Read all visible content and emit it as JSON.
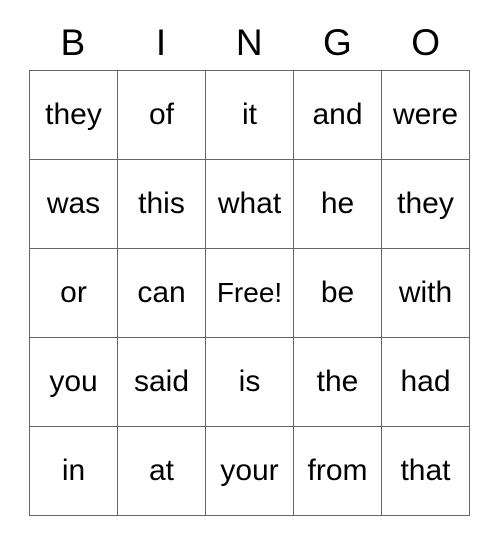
{
  "card": {
    "header": {
      "letters": [
        "B",
        "I",
        "N",
        "G",
        "O"
      ]
    },
    "columns_count": 5,
    "rows_count": 5,
    "free_space_label": "Free!",
    "colors": {
      "text": "#000000",
      "grid_line": "#666666",
      "background": "#ffffff"
    },
    "rows": [
      [
        "they",
        "of",
        "it",
        "and",
        "were"
      ],
      [
        "was",
        "this",
        "what",
        "he",
        "they"
      ],
      [
        "or",
        "can",
        "Free!",
        "be",
        "with"
      ],
      [
        "you",
        "said",
        "is",
        "the",
        "had"
      ],
      [
        "in",
        "at",
        "your",
        "from",
        "that"
      ]
    ]
  }
}
